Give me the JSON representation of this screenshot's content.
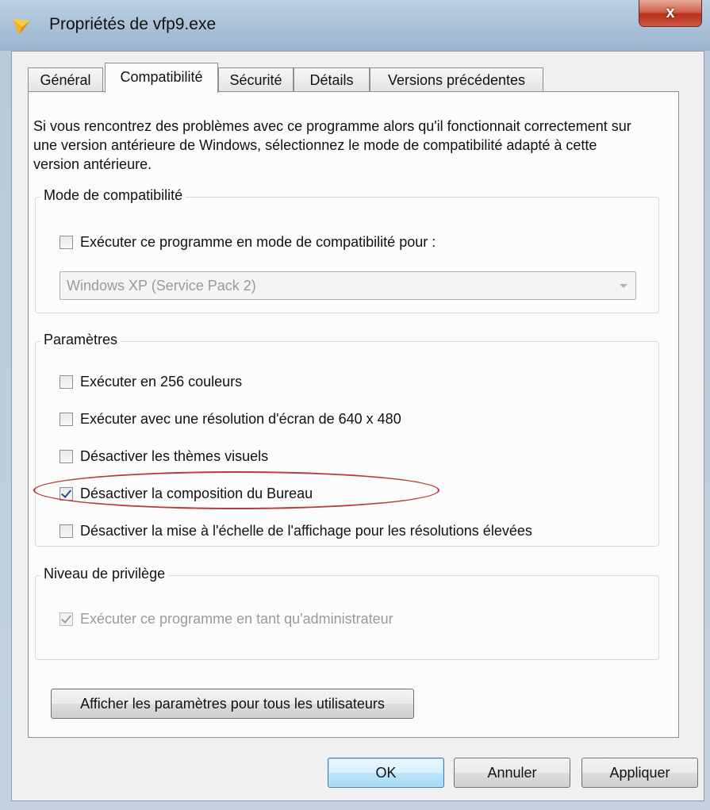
{
  "window": {
    "title": "Propriétés de vfp9.exe",
    "close_label": "x"
  },
  "tabs": [
    {
      "label": "Général"
    },
    {
      "label": "Compatibilité"
    },
    {
      "label": "Sécurité"
    },
    {
      "label": "Détails"
    },
    {
      "label": "Versions précédentes"
    }
  ],
  "intro_text": "Si vous rencontrez des problèmes avec ce programme alors qu'il fonctionnait correctement sur une version antérieure de Windows, sélectionnez le mode de compatibilité adapté à cette version antérieure.",
  "compat_mode": {
    "group_label": "Mode de compatibilité",
    "checkbox_label": "Exécuter ce programme en mode de compatibilité pour :",
    "checked": false,
    "select_value": "Windows XP (Service Pack 2)"
  },
  "settings": {
    "group_label": "Paramètres",
    "items": [
      {
        "label": "Exécuter en 256 couleurs",
        "checked": false
      },
      {
        "label": "Exécuter avec une résolution d'écran de 640 x 480",
        "checked": false
      },
      {
        "label": "Désactiver les thèmes visuels",
        "checked": false
      },
      {
        "label": "Désactiver la composition du Bureau",
        "checked": true
      },
      {
        "label": "Désactiver la mise à l'échelle de l'affichage pour les résolutions élevées",
        "checked": false
      }
    ]
  },
  "privilege": {
    "group_label": "Niveau de privilège",
    "checkbox_label": "Exécuter ce programme en tant qu'administrateur",
    "checked": true
  },
  "all_users_button": "Afficher les paramètres pour tous les utilisateurs",
  "footer": {
    "ok": "OK",
    "cancel": "Annuler",
    "apply": "Appliquer"
  },
  "colors": {
    "highlight_ellipse": "#b83a3a",
    "close_button": "#c8442d"
  }
}
